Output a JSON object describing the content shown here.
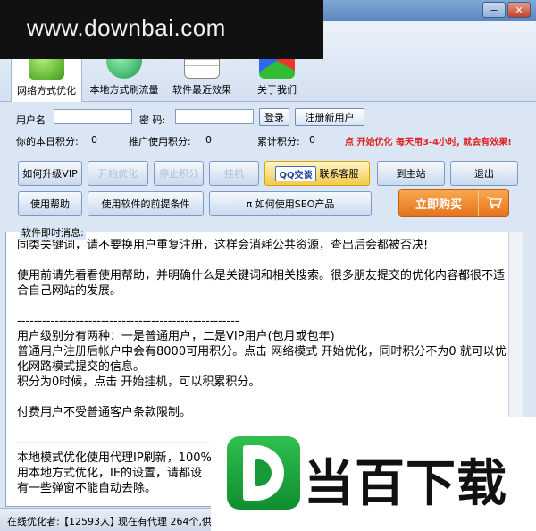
{
  "watermark": {
    "top_text": "www.downbai.com",
    "bottom_text": "当百下载"
  },
  "tabs": [
    {
      "label": "网络方式优化",
      "icon": "leaf-icon",
      "active": true
    },
    {
      "label": "本地方式刷流量",
      "icon": "qq-icon",
      "active": false
    },
    {
      "label": "软件最近效果",
      "icon": "calendar-icon",
      "active": false
    },
    {
      "label": "关于我们",
      "icon": "cube-icon",
      "active": false
    }
  ],
  "login": {
    "username_label": "用户名",
    "password_label": "密  码:",
    "login_button": "登录",
    "register_button": "注册新用户"
  },
  "points": {
    "today_label": "你的本日积分:",
    "today_value": "0",
    "promo_label": "推广使用积分:",
    "promo_value": "0",
    "total_label": "累计积分:",
    "total_value": "0",
    "notice": "点 开始优化 每天用3-4小时, 就会有效果!"
  },
  "buttons": {
    "upgrade_vip": "如何升级VIP",
    "start_optimize": "开始优化",
    "stop": "停止积分",
    "hang": "挂机",
    "qq_badge": "QQ交谈",
    "contact": "联系客服",
    "go_main": "到主站",
    "exit": "退出",
    "help": "使用帮助",
    "prerequisite": "使用软件的前提条件",
    "seo": "π 如何使用SEO产品",
    "buy": "立即购买"
  },
  "messages": {
    "title": "软件即时消息:",
    "text": "同类关键词，请不要换用户重复注册，这样会消耗公共资源，查出后会都被否决!\n\n使用前请先看看使用帮助，并明确什么是关键词和相关搜索。很多朋友提交的优化内容都很不适合自己网站的发展。\n\n-----------------------------------------------------\n用户级别分有两种：一是普通用户，二是VIP用户(包月或包年)\n普通用户注册后帐户中会有8000可用积分。点击 网络模式 开始优化，同时积分不为0 就可以优化网路模式提交的信息。\n积分为0时候，点击 开始挂机，可以积累积分。\n\n付费用户不受普通客户条款限制。\n\n-----------------------------------------------------\n本地模式优化使用代理IP刷新，100%\n用本地方式优化，IE的设置，请都设\n有一些弹窗不能自动去除。"
  },
  "status": {
    "online_label": "在线优化者:",
    "online_value": "【12593人】",
    "proxy": "现在有代理 264个,供本"
  }
}
